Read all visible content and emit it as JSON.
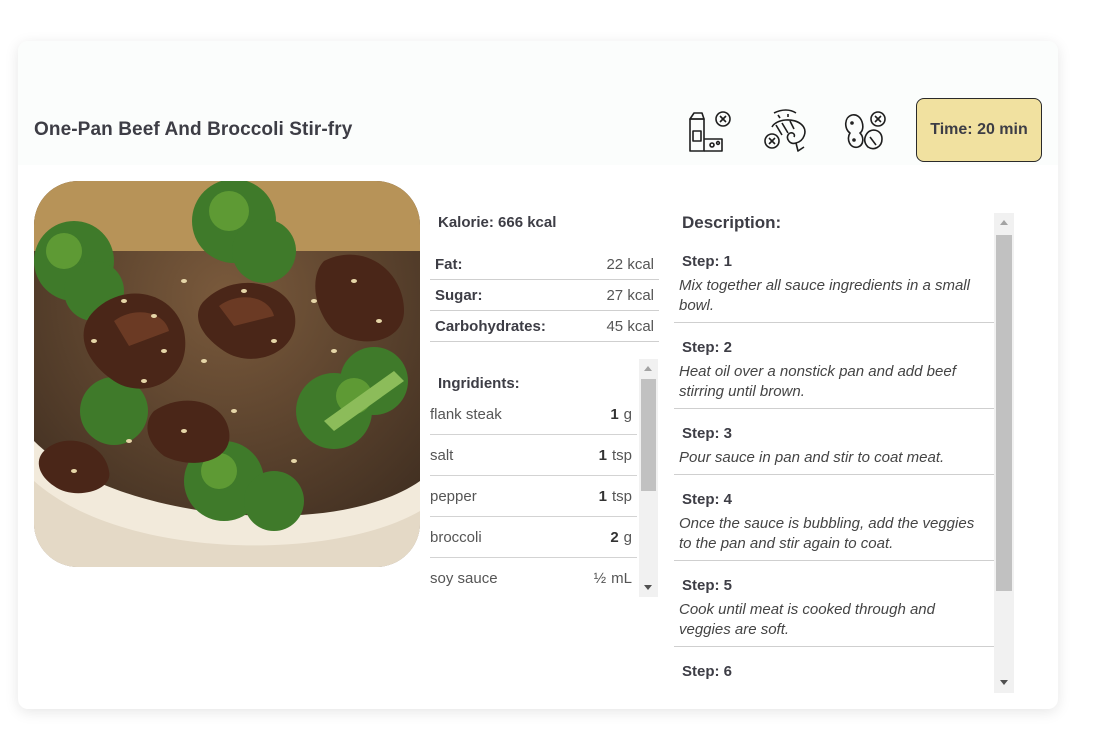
{
  "recipe": {
    "title": "One-Pan Beef And Broccoli Stir-fry",
    "time_label": "Time: 20 min",
    "allergens": [
      "no-dairy-icon",
      "no-seafood-icon",
      "no-nuts-icon"
    ]
  },
  "nutrition": {
    "kalorie": "Kalorie: 666 kcal",
    "rows": [
      {
        "label": "Fat:",
        "value": "22 kcal"
      },
      {
        "label": "Sugar:",
        "value": "27 kcal"
      },
      {
        "label": "Carbohydrates:",
        "value": "45 kcal"
      }
    ]
  },
  "ingredients": {
    "title": "Ingridients:",
    "items": [
      {
        "name": "flank steak",
        "amount": "1",
        "unit": "g"
      },
      {
        "name": "salt",
        "amount": "1",
        "unit": "tsp"
      },
      {
        "name": "pepper",
        "amount": "1",
        "unit": "tsp"
      },
      {
        "name": "broccoli",
        "amount": "2",
        "unit": "g"
      },
      {
        "name": "soy sauce",
        "amount": "½",
        "unit": "mL"
      }
    ]
  },
  "description": {
    "title": "Description:",
    "steps": [
      {
        "title": "Step: 1",
        "text": "Mix together all sauce ingredients in a small bowl."
      },
      {
        "title": "Step: 2",
        "text": "Heat oil over a nonstick pan and add beef stirring until brown."
      },
      {
        "title": "Step: 3",
        "text": "Pour sauce in pan and stir to coat meat."
      },
      {
        "title": "Step: 4",
        "text": "Once the sauce is bubbling, add the veggies to the pan and stir again to coat."
      },
      {
        "title": "Step: 5",
        "text": "Cook until meat is cooked through and veggies are soft."
      },
      {
        "title": "Step: 6",
        "text": ""
      }
    ]
  },
  "colors": {
    "time_badge_bg": "#f1e1a0",
    "divider": "#cfcfcf",
    "scrollbar_thumb": "#c1c1c1"
  }
}
